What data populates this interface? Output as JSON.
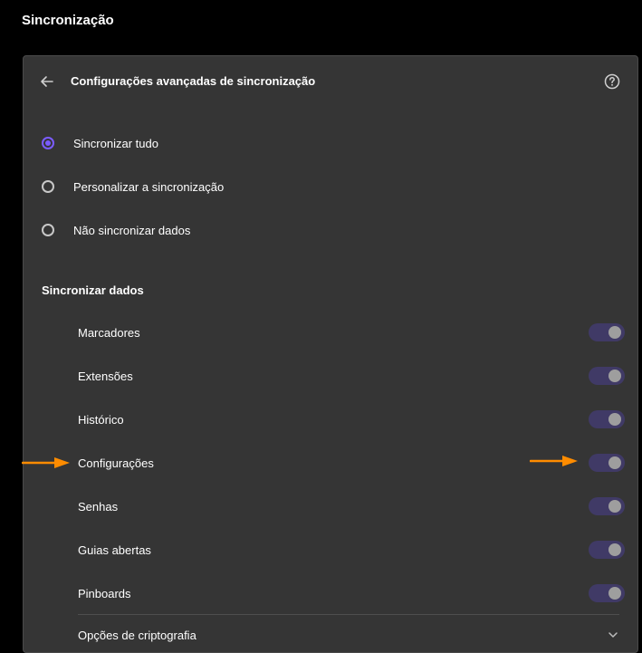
{
  "page": {
    "title": "Sincronização"
  },
  "panel": {
    "header_title": "Configurações avançadas de sincronização",
    "back_icon": "arrow-left-icon",
    "help_icon": "help-circle-icon"
  },
  "sync_modes": [
    {
      "label": "Sincronizar tudo",
      "checked": true
    },
    {
      "label": "Personalizar a sincronização",
      "checked": false
    },
    {
      "label": "Não sincronizar dados",
      "checked": false
    }
  ],
  "sync_data": {
    "title": "Sincronizar dados",
    "items": [
      {
        "label": "Marcadores",
        "enabled": true
      },
      {
        "label": "Extensões",
        "enabled": true
      },
      {
        "label": "Histórico",
        "enabled": true
      },
      {
        "label": "Configurações",
        "enabled": true
      },
      {
        "label": "Senhas",
        "enabled": true
      },
      {
        "label": "Guias abertas",
        "enabled": true
      },
      {
        "label": "Pinboards",
        "enabled": true
      }
    ]
  },
  "encryption": {
    "label": "Opções de criptografia",
    "icon": "chevron-down-icon"
  },
  "colors": {
    "accent": "#7b5cff",
    "toggle_track": "#403a66",
    "annotation_arrow": "#ff8c00"
  }
}
